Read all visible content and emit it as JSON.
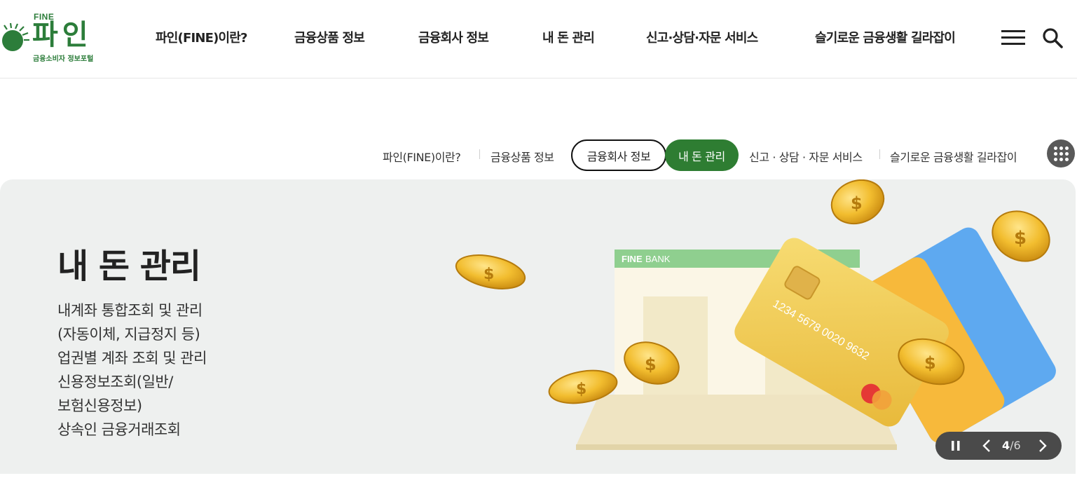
{
  "logo": {
    "fine": "FINE",
    "main": "파인",
    "sub": "금융소비자 정보포털"
  },
  "gnb": {
    "items": [
      {
        "label": "파인(FINE)이란?"
      },
      {
        "label": "금융상품 정보"
      },
      {
        "label": "금융회사 정보"
      },
      {
        "label": "내 돈 관리"
      },
      {
        "label": "신고·상담·자문 서비스"
      },
      {
        "label": "슬기로운 금융생활 길라잡이"
      }
    ],
    "menu_icon": "hamburger-menu-icon",
    "search_icon": "search-icon"
  },
  "subnav": {
    "items": [
      {
        "label": "파인(FINE)이란?"
      },
      {
        "label": "금융상품 정보"
      },
      {
        "label": "금융회사 정보",
        "state": "focused"
      },
      {
        "label": "내 돈 관리",
        "state": "active"
      },
      {
        "label": "신고 · 상담 · 자문 서비스"
      },
      {
        "label": "슬기로운 금융생활 길라잡이"
      }
    ],
    "apps_icon": "grid-apps-icon"
  },
  "banner": {
    "title": "내 돈 관리",
    "lines": [
      "내계좌 통합조회 및 관리",
      "(자동이체, 지급정지 등)",
      "업권별 계좌 조회 및 관리",
      "신용정보조회(일반/",
      "보험신용정보)",
      "상속인 금융거래조회"
    ],
    "illustration": {
      "screen_label_bold": "FINE",
      "screen_label": "BANK",
      "card_number": "1234 5678 0020 9632"
    }
  },
  "carousel": {
    "current": "4",
    "separator": "/",
    "total": "6",
    "pause_icon": "pause-icon",
    "prev_icon": "chevron-left-icon",
    "next_icon": "chevron-right-icon"
  },
  "colors": {
    "brand_green": "#2e7d32",
    "banner_bg": "#eef0ef",
    "control_bg": "#4a4a4a"
  }
}
